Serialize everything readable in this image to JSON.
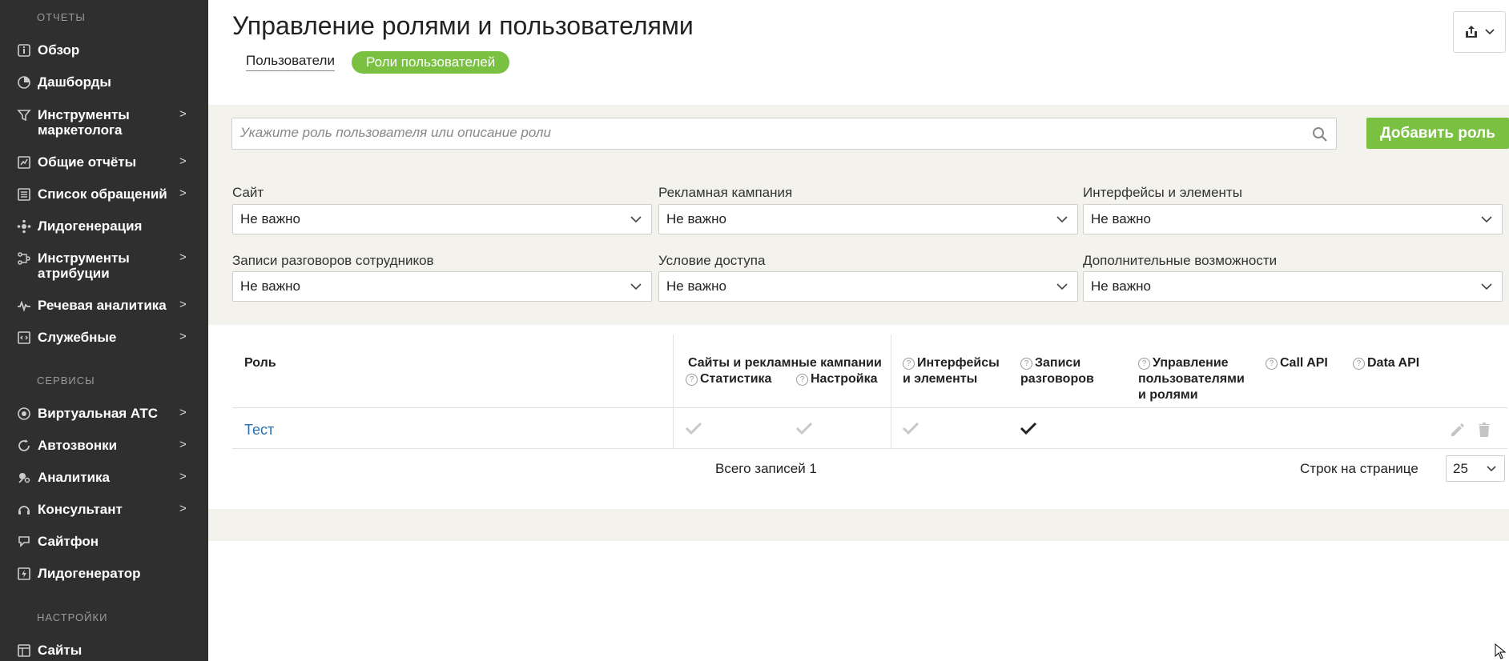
{
  "sidebar": {
    "sections": {
      "reports": "ОТЧЕТЫ",
      "services": "СЕРВИСЫ",
      "settings": "НАСТРОЙКИ"
    },
    "items": [
      {
        "label": "Обзор",
        "icon": "info-icon",
        "arrow": ""
      },
      {
        "label": "Дашборды",
        "icon": "pie-chart-icon",
        "arrow": ""
      },
      {
        "label": "Инструменты маркетолога",
        "icon": "funnel-icon",
        "arrow": ">"
      },
      {
        "label": "Общие отчёты",
        "icon": "report-chart-icon",
        "arrow": ">"
      },
      {
        "label": "Список обращений",
        "icon": "list-icon",
        "arrow": ">"
      },
      {
        "label": "Лидогенерация",
        "icon": "network-icon",
        "arrow": ""
      },
      {
        "label": "Инструменты атрибуции",
        "icon": "attribution-icon",
        "arrow": ">"
      },
      {
        "label": "Речевая аналитика",
        "icon": "waveform-icon",
        "arrow": ">"
      },
      {
        "label": "Служебные",
        "icon": "code-icon",
        "arrow": ">"
      },
      {
        "label": "Виртуальная АТС",
        "icon": "pbx-icon",
        "arrow": ">"
      },
      {
        "label": "Автозвонки",
        "icon": "autocall-icon",
        "arrow": ">"
      },
      {
        "label": "Аналитика",
        "icon": "analytics-icon",
        "arrow": ">"
      },
      {
        "label": "Консультант",
        "icon": "consultant-icon",
        "arrow": ">"
      },
      {
        "label": "Сайтфон",
        "icon": "sitephone-icon",
        "arrow": ""
      },
      {
        "label": "Лидогенератор",
        "icon": "lead-generator-icon",
        "arrow": ""
      },
      {
        "label": "Сайты",
        "icon": "sites-icon",
        "arrow": ""
      }
    ]
  },
  "header": {
    "title": "Управление ролями и пользователями",
    "tabs": [
      "Пользователи",
      "Роли пользователей"
    ],
    "active_tab": "Роли пользователей"
  },
  "search": {
    "placeholder": "Укажите роль пользователя или описание роли",
    "add_button": "Добавить роль"
  },
  "filters": [
    {
      "label": "Сайт",
      "value": "Не важно"
    },
    {
      "label": "Рекламная кампания",
      "value": "Не важно"
    },
    {
      "label": "Интерфейсы и элементы",
      "value": "Не важно"
    },
    {
      "label": "Записи разговоров сотрудников",
      "value": "Не важно"
    },
    {
      "label": "Условие доступа",
      "value": "Не важно"
    },
    {
      "label": "Дополнительные возможности",
      "value": "Не важно"
    }
  ],
  "table": {
    "col_role": "Роль",
    "group_sites": "Сайты и рекламные кампании",
    "col_stat": "Статистика",
    "col_settings": "Настройка",
    "col_interfaces": [
      "Интерфейсы",
      "и элементы"
    ],
    "col_records": [
      "Записи",
      "разговоров"
    ],
    "col_manage": [
      "Управление",
      "пользователями",
      "и ролями"
    ],
    "col_callapi": "Call API",
    "col_dataapi": "Data API",
    "rows": [
      {
        "role": "Тест",
        "statistics": "partial",
        "settings": "partial",
        "interfaces": "partial",
        "records": "full",
        "manage": "none",
        "call_api": "none",
        "data_api": "none"
      }
    ]
  },
  "footer": {
    "total": "Всего записей 1",
    "rows_per_page_label": "Строк на странице",
    "rows_per_page": "25"
  },
  "colors": {
    "sidebar_bg": "#2f2f2f",
    "accent_green": "#7ac142",
    "link_blue": "#2a6fb0",
    "panel_bg": "#f3f2ec"
  }
}
